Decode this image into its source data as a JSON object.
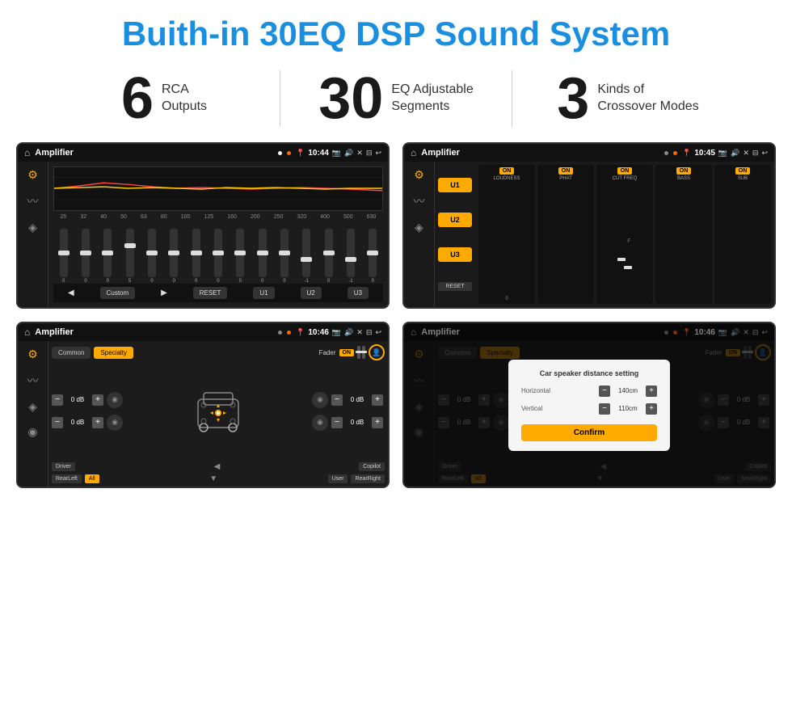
{
  "header": {
    "title": "Buith-in 30EQ DSP Sound System"
  },
  "stats": [
    {
      "number": "6",
      "label": "RCA\nOutputs"
    },
    {
      "number": "30",
      "label": "EQ Adjustable\nSegments"
    },
    {
      "number": "3",
      "label": "Kinds of\nCrossover Modes"
    }
  ],
  "screens": {
    "screen1": {
      "app": "Amplifier",
      "time": "10:44",
      "eq_freqs": [
        "25",
        "32",
        "40",
        "50",
        "63",
        "80",
        "100",
        "125",
        "160",
        "200",
        "250",
        "320",
        "400",
        "500",
        "630"
      ],
      "eq_values": [
        "0",
        "0",
        "0",
        "5",
        "0",
        "0",
        "0",
        "0",
        "0",
        "0",
        "0",
        "-1",
        "0",
        "-1"
      ],
      "preset_label": "Custom",
      "buttons": [
        "RESET",
        "U1",
        "U2",
        "U3"
      ]
    },
    "screen2": {
      "app": "Amplifier",
      "time": "10:45",
      "presets": [
        "U1",
        "U2",
        "U3"
      ],
      "channels": [
        "LOUDNESS",
        "PHAT",
        "CUT FREQ",
        "BASS",
        "SUB"
      ],
      "reset_label": "RESET"
    },
    "screen3": {
      "app": "Amplifier",
      "time": "10:46",
      "tabs": [
        "Common",
        "Specialty"
      ],
      "fader_label": "Fader",
      "fader_on": "ON",
      "db_values": [
        "0 dB",
        "0 dB",
        "0 dB",
        "0 dB"
      ],
      "bottom_buttons": [
        "Driver",
        "Copilot",
        "RearLeft",
        "All",
        "User",
        "RearRight"
      ]
    },
    "screen4": {
      "app": "Amplifier",
      "time": "10:46",
      "tabs": [
        "Common",
        "Specialty"
      ],
      "dialog": {
        "title": "Car speaker distance setting",
        "horizontal_label": "Horizontal",
        "horizontal_value": "140cm",
        "vertical_label": "Vertical",
        "vertical_value": "110cm",
        "confirm_label": "Confirm"
      },
      "db_right": [
        "0 dB",
        "0 dB"
      ],
      "bottom_buttons": [
        "Driver",
        "Copilot",
        "RearLeft",
        "All",
        "User",
        "RearRight"
      ]
    }
  },
  "colors": {
    "accent": "#ffaa00",
    "brand_blue": "#1a8fdf",
    "bg_dark": "#1a1a1a",
    "bg_screen": "#1c1c1c"
  }
}
